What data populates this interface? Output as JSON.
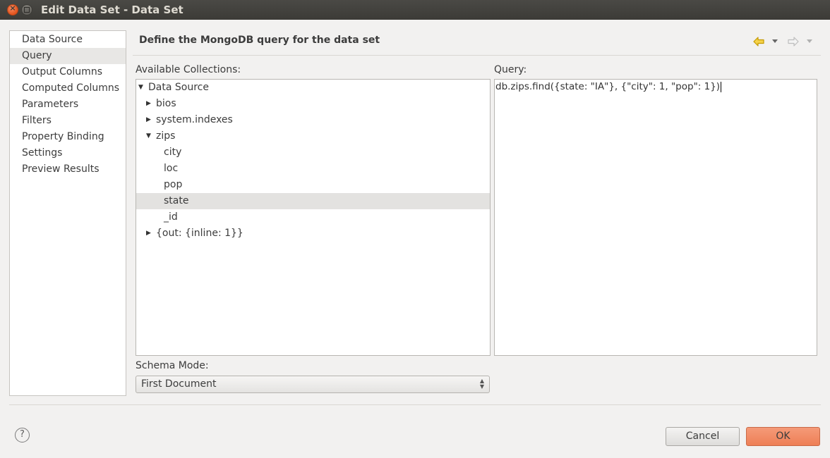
{
  "window": {
    "title": "Edit Data Set - Data Set"
  },
  "nav": {
    "items": [
      {
        "label": "Data Source",
        "selected": false
      },
      {
        "label": "Query",
        "selected": true
      },
      {
        "label": "Output Columns",
        "selected": false
      },
      {
        "label": "Computed Columns",
        "selected": false
      },
      {
        "label": "Parameters",
        "selected": false
      },
      {
        "label": "Filters",
        "selected": false
      },
      {
        "label": "Property Binding",
        "selected": false
      },
      {
        "label": "Settings",
        "selected": false
      },
      {
        "label": "Preview Results",
        "selected": false
      }
    ]
  },
  "page": {
    "title": "Define the MongoDB query for the data set",
    "back_icon": "back-arrow-icon",
    "forward_icon": "forward-arrow-icon",
    "back_color": "#e8b000"
  },
  "collections": {
    "label": "Available Collections:",
    "tree": [
      {
        "label": "Data Source",
        "level": 0,
        "twisty": "expanded",
        "selected": false
      },
      {
        "label": "bios",
        "level": 1,
        "twisty": "collapsed",
        "selected": false
      },
      {
        "label": "system.indexes",
        "level": 1,
        "twisty": "collapsed",
        "selected": false
      },
      {
        "label": "zips",
        "level": 1,
        "twisty": "expanded",
        "selected": false
      },
      {
        "label": "city",
        "level": 2,
        "twisty": "none",
        "selected": false
      },
      {
        "label": "loc",
        "level": 2,
        "twisty": "none",
        "selected": false
      },
      {
        "label": "pop",
        "level": 2,
        "twisty": "none",
        "selected": false
      },
      {
        "label": "state",
        "level": 2,
        "twisty": "none",
        "selected": true
      },
      {
        "label": "_id",
        "level": 2,
        "twisty": "none",
        "selected": false
      },
      {
        "label": "{out: {inline: 1}}",
        "level": 1,
        "twisty": "collapsed",
        "selected": false
      }
    ]
  },
  "query": {
    "label": "Query:",
    "text": "db.zips.find({state: \"IA\"}, {\"city\": 1, \"pop\": 1})"
  },
  "schema": {
    "label": "Schema Mode:",
    "value": "First Document"
  },
  "footer": {
    "help_symbol": "?",
    "cancel_label": "Cancel",
    "ok_label": "OK",
    "ok_color": "#f08a64"
  }
}
